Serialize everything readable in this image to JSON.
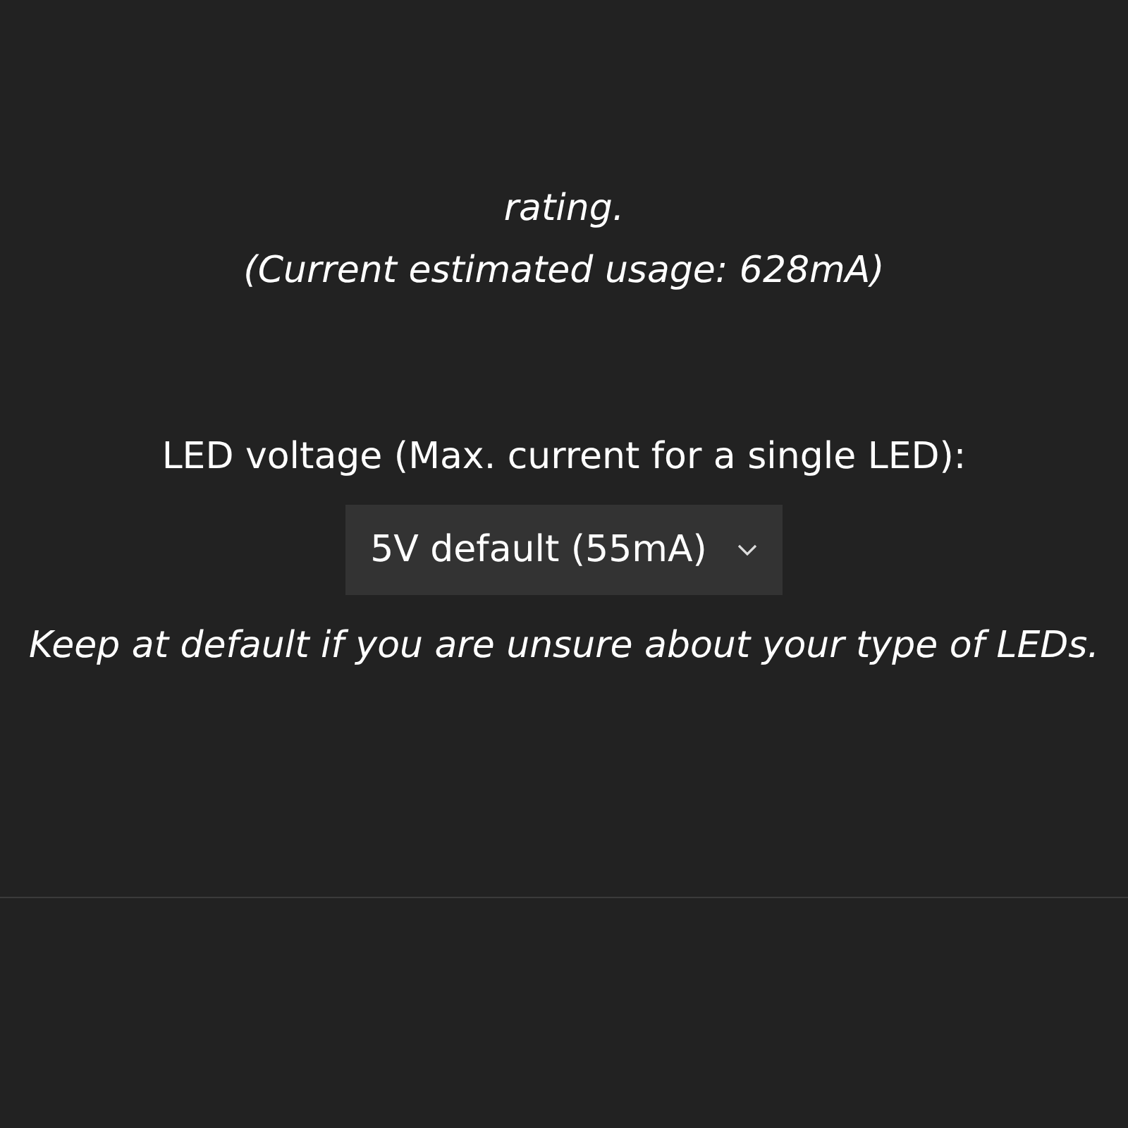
{
  "cut_text": "rating.",
  "usage_note": "(Current estimated usage: 628mA)",
  "voltage_label": "LED voltage (Max. current for a single LED):",
  "voltage_select": {
    "value": "5V default (55mA)"
  },
  "hint": "Keep at default if you are unsure about your type of LEDs."
}
